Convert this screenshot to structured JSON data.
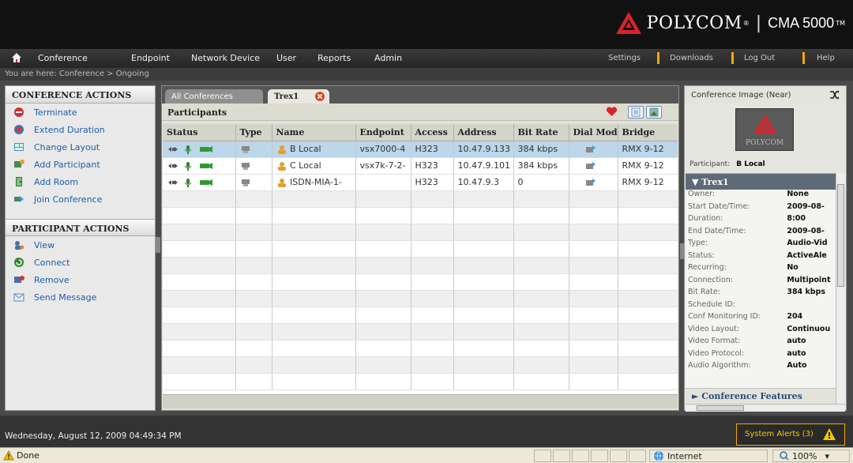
{
  "brand": {
    "name": "POLYCOM",
    "product": "CMA 5000",
    "tm": "TM"
  },
  "nav": {
    "items": [
      "Conference",
      "Endpoint",
      "Network Device",
      "User",
      "Reports",
      "Admin"
    ],
    "right": [
      "Settings",
      "Downloads",
      "Log Out",
      "Help"
    ]
  },
  "breadcrumb": "You are here:  Conference  >  Ongoing",
  "left": {
    "conference_actions_title": "CONFERENCE ACTIONS",
    "conference_actions": [
      "Terminate",
      "Extend Duration",
      "Change Layout",
      "Add Participant",
      "Add Room",
      "Join Conference"
    ],
    "participant_actions_title": "PARTICIPANT ACTIONS",
    "participant_actions": [
      "View",
      "Connect",
      "Remove",
      "Send Message"
    ]
  },
  "tabs": {
    "all": "All Conferences",
    "current": "Trex1"
  },
  "participants": {
    "title": "Participants",
    "columns": [
      "Status",
      "Type",
      "Name",
      "Endpoint",
      "Access",
      "Address",
      "Bit Rate",
      "Dial Mod",
      "Bridge"
    ],
    "rows": [
      {
        "name": "B Local",
        "endpoint": "vsx7000-4",
        "access": "H323",
        "address": "10.47.9.133",
        "bitrate": "384 kbps",
        "bridge": "RMX 9-12"
      },
      {
        "name": "C Local",
        "endpoint": "vsx7k-7-2-",
        "access": "H323",
        "address": "10.47.9.101",
        "bitrate": "384 kbps",
        "bridge": "RMX 9-12"
      },
      {
        "name": "ISDN-MIA-1-",
        "endpoint": "",
        "access": "H323",
        "address": "10.47.9.3",
        "bitrate": "0",
        "bridge": "RMX 9-12"
      }
    ]
  },
  "right": {
    "image_title": "Conference Image (Near)",
    "image_brand": "POLYCOM",
    "participant_label": "Participant:",
    "participant_value": "B Local",
    "conf_name": "Trex1",
    "details": [
      {
        "label": "Owner:",
        "value": "None"
      },
      {
        "label": "Start Date/Time:",
        "value": "2009-08-"
      },
      {
        "label": "Duration:",
        "value": "8:00"
      },
      {
        "label": "End Date/Time:",
        "value": "2009-08-"
      },
      {
        "label": "Type:",
        "value": "Audio-Vid"
      },
      {
        "label": "Status:",
        "value": "ActiveAle"
      },
      {
        "label": "Recurring:",
        "value": "No"
      },
      {
        "label": "Connection:",
        "value": "Multipoint"
      },
      {
        "label": "Bit Rate:",
        "value": "384 kbps"
      },
      {
        "label": "Schedule ID:",
        "value": ""
      },
      {
        "label": "Conf Monitoring ID:",
        "value": "204"
      },
      {
        "label": "Video Layout:",
        "value": "Continuou"
      },
      {
        "label": "Video Format:",
        "value": "auto"
      },
      {
        "label": "Video Protocol:",
        "value": "auto"
      },
      {
        "label": "Audio Algorithm:",
        "value": "Auto"
      }
    ],
    "features": "Conference Features"
  },
  "footer": {
    "datetime": "Wednesday, August 12, 2009 04:49:34 PM",
    "alerts": "System Alerts (3)"
  },
  "statusbar": {
    "done": "Done",
    "zone": "Internet",
    "zoom": "100%"
  },
  "colors": {
    "accent": "#f2a900",
    "polycom_red": "#d8232a",
    "link": "#1d5fa8",
    "selected_row": "#bcd6ea"
  }
}
